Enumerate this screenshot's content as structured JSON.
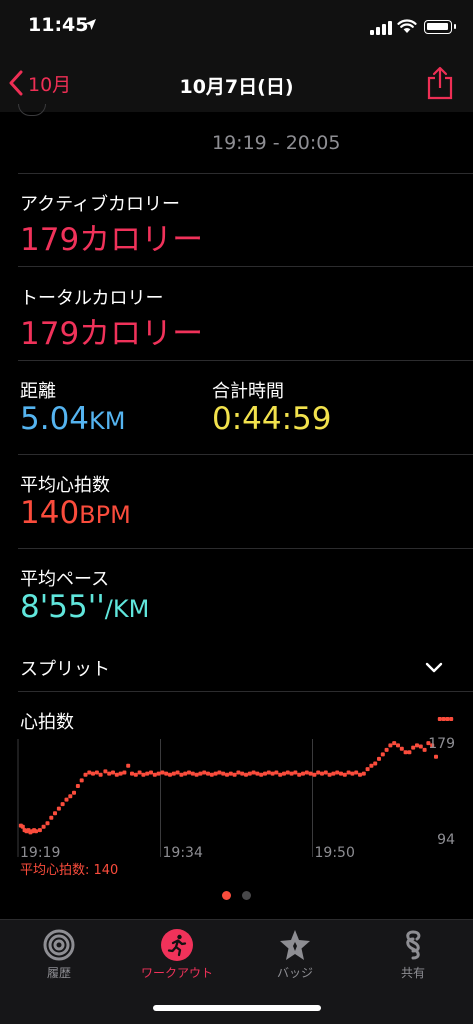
{
  "status_bar": {
    "time": "11:45"
  },
  "nav": {
    "back_label": "10月",
    "title": "10月7日(日)"
  },
  "workout": {
    "time_range": "19:19 - 20:05"
  },
  "metrics": {
    "active_calories_label": "アクティブカロリー",
    "active_calories_value": "179カロリー",
    "total_calories_label": "トータルカロリー",
    "total_calories_value": "179カロリー",
    "distance_label": "距離",
    "distance_number": "5.04",
    "distance_unit": "KM",
    "total_time_label": "合計時間",
    "total_time_value": "0:44:59",
    "avg_hr_label": "平均心拍数",
    "avg_hr_number": "140",
    "avg_hr_unit": "BPM",
    "avg_pace_label": "平均ペース",
    "avg_pace_number": "8'55''",
    "avg_pace_unit": "/KM"
  },
  "splits": {
    "label": "スプリット"
  },
  "heart_rate": {
    "label": "心拍数",
    "avg_note": "平均心拍数: 140",
    "color": "#fa4c3c"
  },
  "chart_data": {
    "type": "scatter",
    "title": "心拍数",
    "x_tick_labels": [
      "19:19",
      "19:34",
      "19:50"
    ],
    "y_tick_labels": [
      "179",
      "94"
    ],
    "ylim": [
      94,
      179
    ],
    "x": [
      19.3,
      19.5,
      19.7,
      19.9,
      20.1,
      20.3,
      20.5,
      20.7,
      20.9,
      21.3,
      21.7,
      22.1,
      22.5,
      22.9,
      23.3,
      23.7,
      24.1,
      24.5,
      24.9,
      25.3,
      25.7,
      26.1,
      26.5,
      26.9,
      27.3,
      27.7,
      28.2,
      28.6,
      29.0,
      29.4,
      29.8,
      30.2,
      30.6,
      31.0,
      31.4,
      31.8,
      32.2,
      32.6,
      33.0,
      33.4,
      33.8,
      34.2,
      34.6,
      35.0,
      35.4,
      35.8,
      36.2,
      36.6,
      37.0,
      37.4,
      37.8,
      38.2,
      38.6,
      39.0,
      39.4,
      39.8,
      40.2,
      40.6,
      41.0,
      41.4,
      41.8,
      42.2,
      42.6,
      43.0,
      43.4,
      43.8,
      44.2,
      44.6,
      45.0,
      45.4,
      45.8,
      46.2,
      46.6,
      47.0,
      47.4,
      47.8,
      48.2,
      48.6,
      49.0,
      49.4,
      49.8,
      50.2,
      50.6,
      51.0,
      51.4,
      51.8,
      52.2,
      52.6,
      53.0,
      53.4,
      53.8,
      54.2,
      54.6,
      55.0,
      55.4,
      55.8,
      56.2,
      56.6,
      57.0,
      57.4,
      57.8,
      58.2,
      58.6,
      59.0,
      59.4,
      59.8,
      60.2,
      60.6,
      61.0,
      61.4,
      61.8,
      62.2,
      62.6,
      63.0,
      63.4,
      63.8,
      64.2,
      64.6
    ],
    "values": [
      105,
      104,
      101,
      100,
      101,
      99,
      100,
      101,
      100,
      101,
      104,
      107,
      112,
      116,
      120,
      124,
      128,
      131,
      134,
      140,
      145,
      150,
      152,
      151,
      152,
      150,
      153,
      151,
      152,
      150,
      151,
      152,
      158,
      151,
      150,
      152,
      150,
      151,
      152,
      150,
      151,
      152,
      151,
      150,
      151,
      152,
      150,
      151,
      152,
      151,
      150,
      151,
      152,
      151,
      150,
      151,
      152,
      151,
      150,
      151,
      150,
      152,
      151,
      150,
      151,
      152,
      151,
      150,
      151,
      152,
      151,
      152,
      150,
      151,
      152,
      151,
      152,
      150,
      151,
      152,
      151,
      150,
      152,
      151,
      152,
      150,
      151,
      152,
      151,
      150,
      152,
      151,
      152,
      150,
      151,
      155,
      158,
      160,
      164,
      168,
      172,
      176,
      178,
      176,
      173,
      170,
      170,
      174,
      176,
      175,
      172,
      178,
      176,
      166
    ]
  },
  "tabs": [
    {
      "label": "履歴",
      "icon": "history-rings-icon",
      "active": false
    },
    {
      "label": "ワークアウト",
      "icon": "running-figure-icon",
      "active": true
    },
    {
      "label": "バッジ",
      "icon": "award-badge-icon",
      "active": false
    },
    {
      "label": "共有",
      "icon": "sharing-icon",
      "active": false
    }
  ],
  "colors": {
    "accent": "#f0325a",
    "distance": "#55b4f0",
    "duration": "#f2e24d",
    "heart_rate": "#fa4c3c",
    "pace": "#60e6dc"
  }
}
